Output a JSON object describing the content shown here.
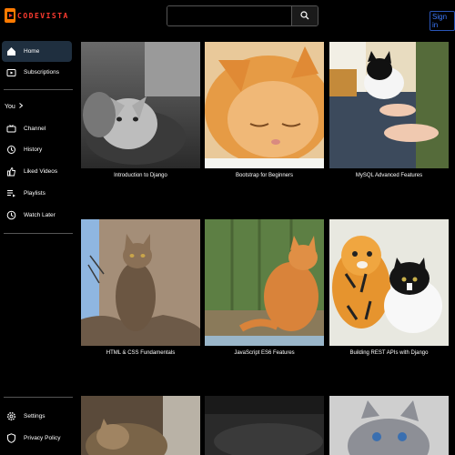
{
  "brand": {
    "name": "CODEVISTA"
  },
  "search": {
    "placeholder": "",
    "value": ""
  },
  "header": {
    "signin_label": "Sign in"
  },
  "sidebar": {
    "primary": [
      {
        "label": "Home",
        "icon": "home-icon",
        "active": true
      },
      {
        "label": "Subscriptions",
        "icon": "subscriptions-icon",
        "active": false
      }
    ],
    "you_title": "You",
    "you_items": [
      {
        "label": "Channel",
        "icon": "channel-icon"
      },
      {
        "label": "History",
        "icon": "history-icon"
      },
      {
        "label": "Liked Videos",
        "icon": "thumbs-up-icon"
      },
      {
        "label": "Playlists",
        "icon": "playlist-icon"
      },
      {
        "label": "Watch Later",
        "icon": "clock-icon"
      }
    ],
    "footer_items": [
      {
        "label": "Settings",
        "icon": "gear-icon"
      },
      {
        "label": "Privacy Policy",
        "icon": "shield-icon"
      }
    ]
  },
  "videos": [
    {
      "title": "Introduction to Django"
    },
    {
      "title": "Bootstrap for Beginners"
    },
    {
      "title": "MySQL Advanced Features"
    },
    {
      "title": "HTML & CSS Fundamentals"
    },
    {
      "title": "JavaScript ES6 Features"
    },
    {
      "title": "Building REST APIs with Django"
    },
    {
      "title": ""
    },
    {
      "title": ""
    },
    {
      "title": ""
    }
  ],
  "colors": {
    "brand": "#ff3b30",
    "accent": "#3d7bff",
    "active_bg": "#1f2f3f"
  }
}
